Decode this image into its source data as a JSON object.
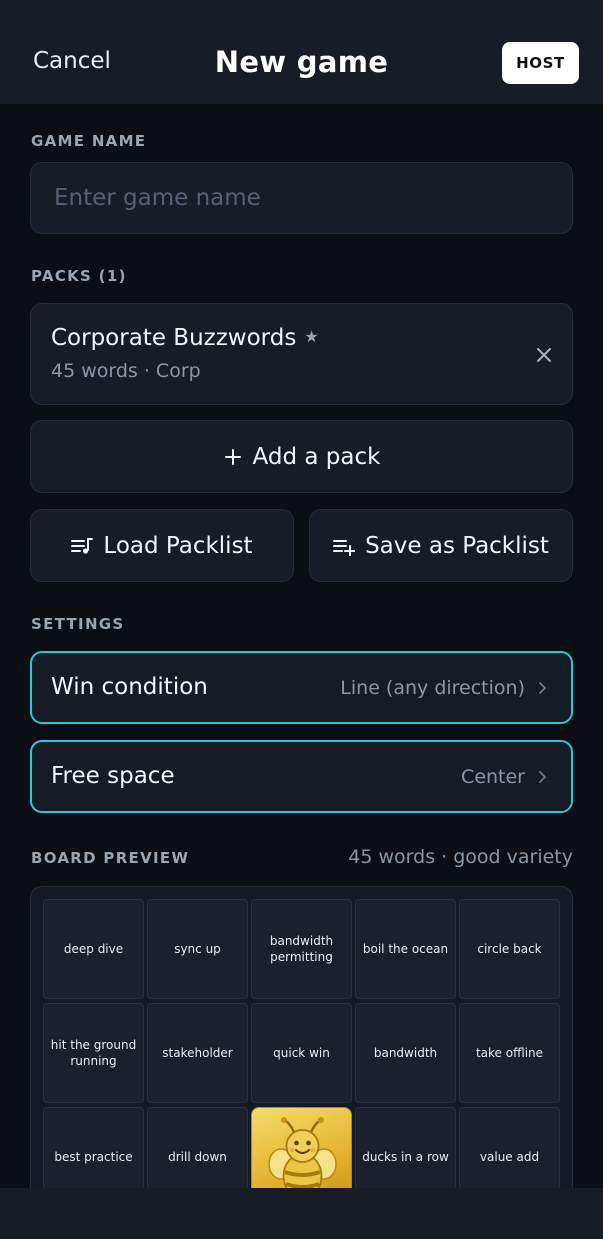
{
  "header": {
    "cancel_label": "Cancel",
    "title": "New game",
    "host_label": "HOST"
  },
  "game_name": {
    "label": "GAME NAME",
    "placeholder": "Enter game name",
    "value": ""
  },
  "packs": {
    "label": "PACKS (1)",
    "items": [
      {
        "name": "Corporate Buzzwords",
        "meta": "45 words · Corp",
        "starred": true
      }
    ],
    "add_label": "Add a pack",
    "load_label": "Load Packlist",
    "save_label": "Save as Packlist"
  },
  "settings": {
    "label": "SETTINGS",
    "win_condition": {
      "label": "Win condition",
      "value": "Line (any direction)"
    },
    "free_space": {
      "label": "Free space",
      "value": "Center"
    }
  },
  "board_preview": {
    "label": "BOARD PREVIEW",
    "meta": "45 words · good variety",
    "rows": [
      [
        "deep dive",
        "sync up",
        "bandwidth permitting",
        "boil the ocean",
        "circle back"
      ],
      [
        "hit the ground running",
        "stakeholder",
        "quick win",
        "bandwidth",
        "take offline"
      ],
      [
        "best practice",
        "drill down",
        "",
        "ducks in a row",
        "value add"
      ]
    ],
    "free_icon": "bee-icon"
  },
  "icons": {
    "star": "star-icon",
    "remove": "close-icon",
    "add": "plus-icon",
    "load": "playlist-music-icon",
    "save": "playlist-add-icon",
    "chevron": "chevron-right-icon"
  },
  "colors": {
    "background": "#0b0e14",
    "surface": "#171c27",
    "accent": "#2ec5d6",
    "free_space_gold": "#e5b532"
  }
}
